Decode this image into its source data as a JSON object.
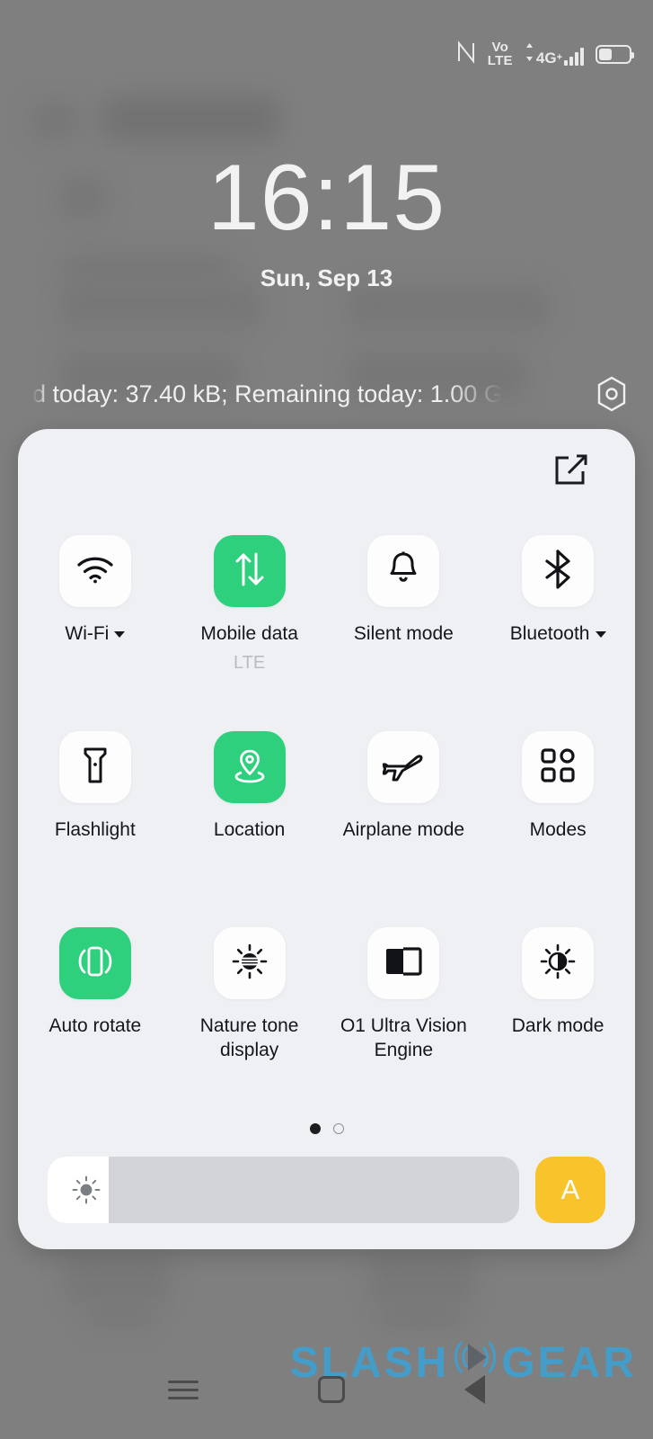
{
  "status_bar": {
    "nfc_icon": "nfc-icon",
    "volte_top": "Vo",
    "volte_bottom": "LTE",
    "network_label": "4G",
    "network_sup": "+",
    "signal_bars": 4,
    "battery_icon": "battery-icon",
    "battery_level_percent": 40
  },
  "lockscreen": {
    "time": "16:15",
    "date": "Sun, Sep 13",
    "data_usage_text": "d today: 37.40 kB; Remaining today: 1.00 G",
    "settings_icon": "hexagon-settings-icon"
  },
  "quick_settings": {
    "edit_icon": "edit-square-icon",
    "tiles": [
      {
        "label": "Wi-Fi",
        "icon": "wifi-icon",
        "state": "off",
        "has_caret": true,
        "sub": ""
      },
      {
        "label": "Mobile data",
        "icon": "data-transfer-icon",
        "state": "on",
        "has_caret": false,
        "sub": "LTE"
      },
      {
        "label": "Silent mode",
        "icon": "bell-icon",
        "state": "off",
        "has_caret": false,
        "sub": ""
      },
      {
        "label": "Bluetooth",
        "icon": "bluetooth-icon",
        "state": "off",
        "has_caret": true,
        "sub": ""
      },
      {
        "label": "Flashlight",
        "icon": "flashlight-icon",
        "state": "off",
        "has_caret": false,
        "sub": ""
      },
      {
        "label": "Location",
        "icon": "location-pin-icon",
        "state": "on",
        "has_caret": false,
        "sub": ""
      },
      {
        "label": "Airplane mode",
        "icon": "airplane-icon",
        "state": "off",
        "has_caret": false,
        "sub": ""
      },
      {
        "label": "Modes",
        "icon": "grid-modes-icon",
        "state": "off",
        "has_caret": false,
        "sub": ""
      },
      {
        "label": "Auto rotate",
        "icon": "auto-rotate-icon",
        "state": "on",
        "has_caret": false,
        "sub": ""
      },
      {
        "label": "Nature tone display",
        "icon": "nature-tone-icon",
        "state": "off",
        "has_caret": false,
        "sub": ""
      },
      {
        "label": "O1 Ultra Vision Engine",
        "icon": "split-screen-icon",
        "state": "off",
        "has_caret": false,
        "sub": ""
      },
      {
        "label": "Dark mode",
        "icon": "half-sun-icon",
        "state": "off",
        "has_caret": false,
        "sub": ""
      }
    ],
    "pager": {
      "total": 2,
      "active_index": 0
    },
    "brightness": {
      "slider_icon": "sun-icon",
      "value_percent": 13,
      "auto_label": "A",
      "auto_color": "#f9c32c"
    },
    "colors": {
      "panel_bg": "#eef0f4",
      "tile_off_bg": "#fdfdfd",
      "tile_on_bg": "#2ecf7d",
      "slider_track": "#d2d4d7"
    }
  },
  "nav_bar": {
    "recents_icon": "recents-menu-icon",
    "home_icon": "home-square-icon",
    "back_icon": "back-triangle-icon"
  },
  "watermark": {
    "text_left": "SLASH",
    "text_right": "GEAR",
    "radar_icon": "radar-logo-icon",
    "color": "#3f9fd0"
  }
}
